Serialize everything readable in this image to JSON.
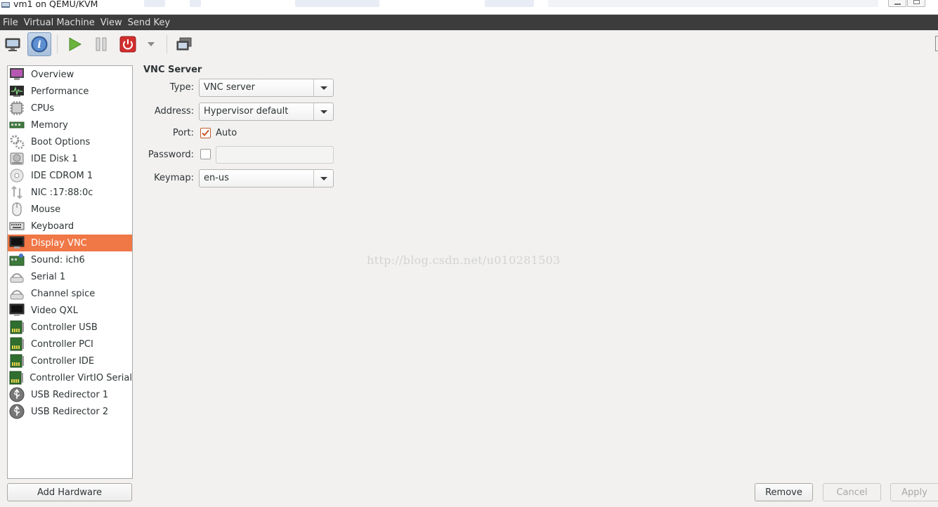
{
  "window": {
    "title": "vm1 on QEMU/KVM"
  },
  "menubar": {
    "items": [
      "File",
      "Virtual Machine",
      "View",
      "Send Key"
    ]
  },
  "toolbar": {
    "buttons": [
      {
        "icon": "console-monitor-icon",
        "active": false
      },
      {
        "icon": "details-info-icon",
        "active": true
      },
      {
        "icon": "run-play-icon",
        "active": false
      },
      {
        "icon": "pause-icon",
        "active": false
      },
      {
        "icon": "shutdown-power-icon",
        "active": false
      },
      {
        "icon": "shutdown-menu-chevron-icon",
        "active": false
      },
      {
        "icon": "fullscreen-icon",
        "active": false
      }
    ]
  },
  "sidebar": {
    "items": [
      {
        "label": "Overview",
        "icon": "overview-icon"
      },
      {
        "label": "Performance",
        "icon": "performance-icon"
      },
      {
        "label": "CPUs",
        "icon": "cpu-icon"
      },
      {
        "label": "Memory",
        "icon": "memory-icon"
      },
      {
        "label": "Boot Options",
        "icon": "boot-options-icon"
      },
      {
        "label": "IDE Disk 1",
        "icon": "disk-icon"
      },
      {
        "label": "IDE CDROM 1",
        "icon": "cdrom-icon"
      },
      {
        "label": "NIC :17:88:0c",
        "icon": "network-icon"
      },
      {
        "label": "Mouse",
        "icon": "mouse-icon"
      },
      {
        "label": "Keyboard",
        "icon": "keyboard-icon"
      },
      {
        "label": "Display VNC",
        "icon": "display-icon",
        "selected": true
      },
      {
        "label": "Sound: ich6",
        "icon": "sound-card-icon"
      },
      {
        "label": "Serial 1",
        "icon": "serial-icon"
      },
      {
        "label": "Channel spice",
        "icon": "channel-icon"
      },
      {
        "label": "Video QXL",
        "icon": "video-icon"
      },
      {
        "label": "Controller USB",
        "icon": "controller-icon"
      },
      {
        "label": "Controller PCI",
        "icon": "controller-icon"
      },
      {
        "label": "Controller IDE",
        "icon": "controller-icon"
      },
      {
        "label": "Controller VirtIO Serial",
        "icon": "controller-icon"
      },
      {
        "label": "USB Redirector 1",
        "icon": "usb-icon"
      },
      {
        "label": "USB Redirector 2",
        "icon": "usb-icon"
      }
    ],
    "add_hardware_label": "Add Hardware"
  },
  "vnc": {
    "section_title": "VNC Server",
    "type_label": "Type:",
    "type_value": "VNC server",
    "address_label": "Address:",
    "address_value": "Hypervisor default",
    "port_label": "Port:",
    "port_auto_label": "Auto",
    "port_auto_checked": true,
    "password_label": "Password:",
    "password_checked": false,
    "password_value": "",
    "keymap_label": "Keymap:",
    "keymap_value": "en-us"
  },
  "watermark": "http://blog.csdn.net/u010281503",
  "actions": {
    "remove_label": "Remove",
    "cancel_label": "Cancel",
    "apply_label": "Apply"
  },
  "colors": {
    "selection": "#f07746",
    "menubar_bg": "#3c3c3c",
    "window_bg": "#f2f1f0"
  }
}
